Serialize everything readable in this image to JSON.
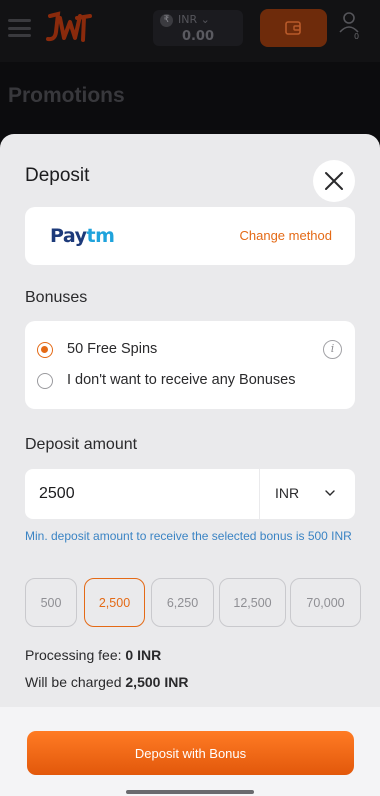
{
  "header": {
    "currency": "INR",
    "balance": "0.00",
    "notifications_count": "0"
  },
  "page": {
    "title": "Promotions"
  },
  "deposit": {
    "title": "Deposit",
    "method": {
      "brand_pay": "Pay",
      "brand_tm": "tm",
      "change_label": "Change method"
    },
    "bonuses": {
      "label": "Bonuses",
      "options": [
        {
          "label": "50 Free Spins",
          "selected": true
        },
        {
          "label": "I don't want to receive any Bonuses",
          "selected": false
        }
      ]
    },
    "amount": {
      "label": "Deposit amount",
      "value": "2500",
      "currency": "INR",
      "hint": "Min. deposit amount to receive the selected bonus is 500 INR"
    },
    "quick_amounts": [
      {
        "label": "500",
        "active": false
      },
      {
        "label": "2,500",
        "active": true
      },
      {
        "label": "6,250",
        "active": false
      },
      {
        "label": "12,500",
        "active": false
      },
      {
        "label": "70,000",
        "active": false
      }
    ],
    "fee": {
      "label": "Processing fee:",
      "value": "0 INR"
    },
    "charged": {
      "label": "Will be charged",
      "value": "2,500 INR"
    },
    "submit_label": "Deposit with Bonus"
  },
  "colors": {
    "accent": "#e46a16",
    "hint_blue": "#3b84c4",
    "sheet_bg": "#eaeaec"
  },
  "icons": {
    "menu": "hamburger-icon",
    "close": "close-icon",
    "info": "info-icon",
    "chevron": "chevron-down-icon",
    "wallet": "wallet-icon",
    "profile": "user-icon"
  }
}
